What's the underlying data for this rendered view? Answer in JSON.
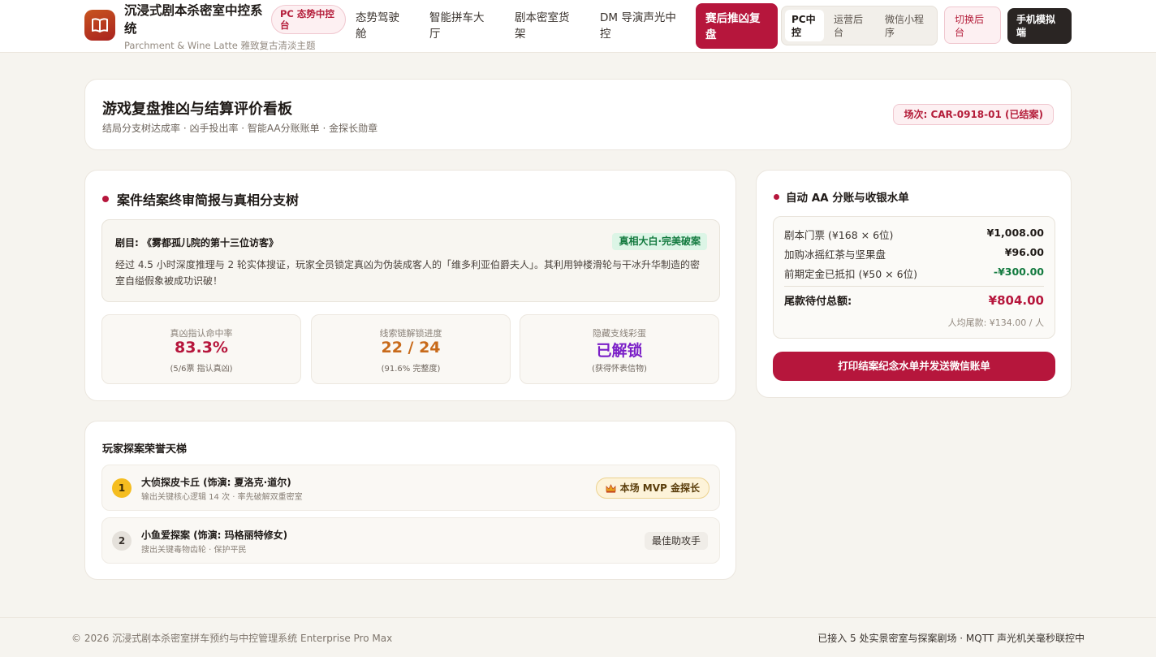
{
  "header": {
    "brand_title": "沉浸式剧本杀密室中控系统",
    "brand_subtitle": "Parchment & Wine Latte 雅致复古清淡主题",
    "pc_badge": "PC 态势中控台",
    "nav": [
      "态势驾驶舱",
      "智能拼车大厅",
      "剧本密室货架",
      "DM 导演声光中控"
    ],
    "nav_active": "赛后推凶复盘",
    "segments": [
      "PC中控",
      "运营后台",
      "微信小程序"
    ],
    "switch_label": "切换后台",
    "mobile_label": "手机模拟端"
  },
  "title_card": {
    "title": "游戏复盘推凶与结算评价看板",
    "subtitle": "结局分支树达成率 · 凶手投出率 · 智能AA分账账单 · 金探长勋章",
    "session": "场次: CAR-0918-01 (已结案)"
  },
  "case": {
    "section_title": "案件结案终审简报与真相分支树",
    "script_name": "剧目: 《雾都孤儿院的第十三位访客》",
    "truth_tag": "真相大白·完美破案",
    "description": "经过 4.5 小时深度推理与 2 轮实体搜证，玩家全员锁定真凶为伪装成客人的「维多利亚伯爵夫人」。其利用钟楼滑轮与干冰升华制造的密室自缢假象被成功识破！",
    "stats": [
      {
        "label": "真凶指认命中率",
        "value": "83.3%",
        "note": "(5/6票 指认真凶)",
        "color": "#b6163c"
      },
      {
        "label": "线索链解锁进度",
        "value": "22 / 24",
        "note": "(91.6% 完整度)",
        "color": "#c86a1a"
      },
      {
        "label": "隐藏支线彩蛋",
        "value": "已解锁",
        "note": "(获得怀表信物)",
        "color": "#7b1fc7"
      }
    ]
  },
  "aa": {
    "section_title": "自动 AA 分账与收银水单",
    "rows": [
      {
        "label": "剧本门票 (¥168 × 6位)",
        "amount": "¥1,008.00"
      },
      {
        "label": "加购冰摇红茶与坚果盘",
        "amount": "¥96.00"
      },
      {
        "label": "前期定金已抵扣 (¥50 × 6位)",
        "amount": "-¥300.00"
      }
    ],
    "total_label": "尾款待付总额:",
    "total_value": "¥804.00",
    "per_person": "人均尾款: ¥134.00 / 人",
    "print_button": "打印结案纪念水单并发送微信账单"
  },
  "ranking": {
    "title": "玩家探案荣誉天梯",
    "players": [
      {
        "rank": "1",
        "name": "大侦探皮卡丘 (饰演: 夏洛克·道尔)",
        "desc": "输出关键核心逻辑 14 次 · 率先破解双重密室",
        "badge": "本场 MVP 金探长"
      },
      {
        "rank": "2",
        "name": "小鱼爱探案 (饰演: 玛格丽特修女)",
        "desc": "搜出关键毒物齿轮 · 保护平民",
        "badge": "最佳助攻手"
      }
    ]
  },
  "footer": {
    "left": "© 2026 沉浸式剧本杀密室拼车预约与中控管理系统 Enterprise Pro Max",
    "right": "已接入 5 处实景密室与探案剧场 · MQTT 声光机关毫秒联控中"
  }
}
